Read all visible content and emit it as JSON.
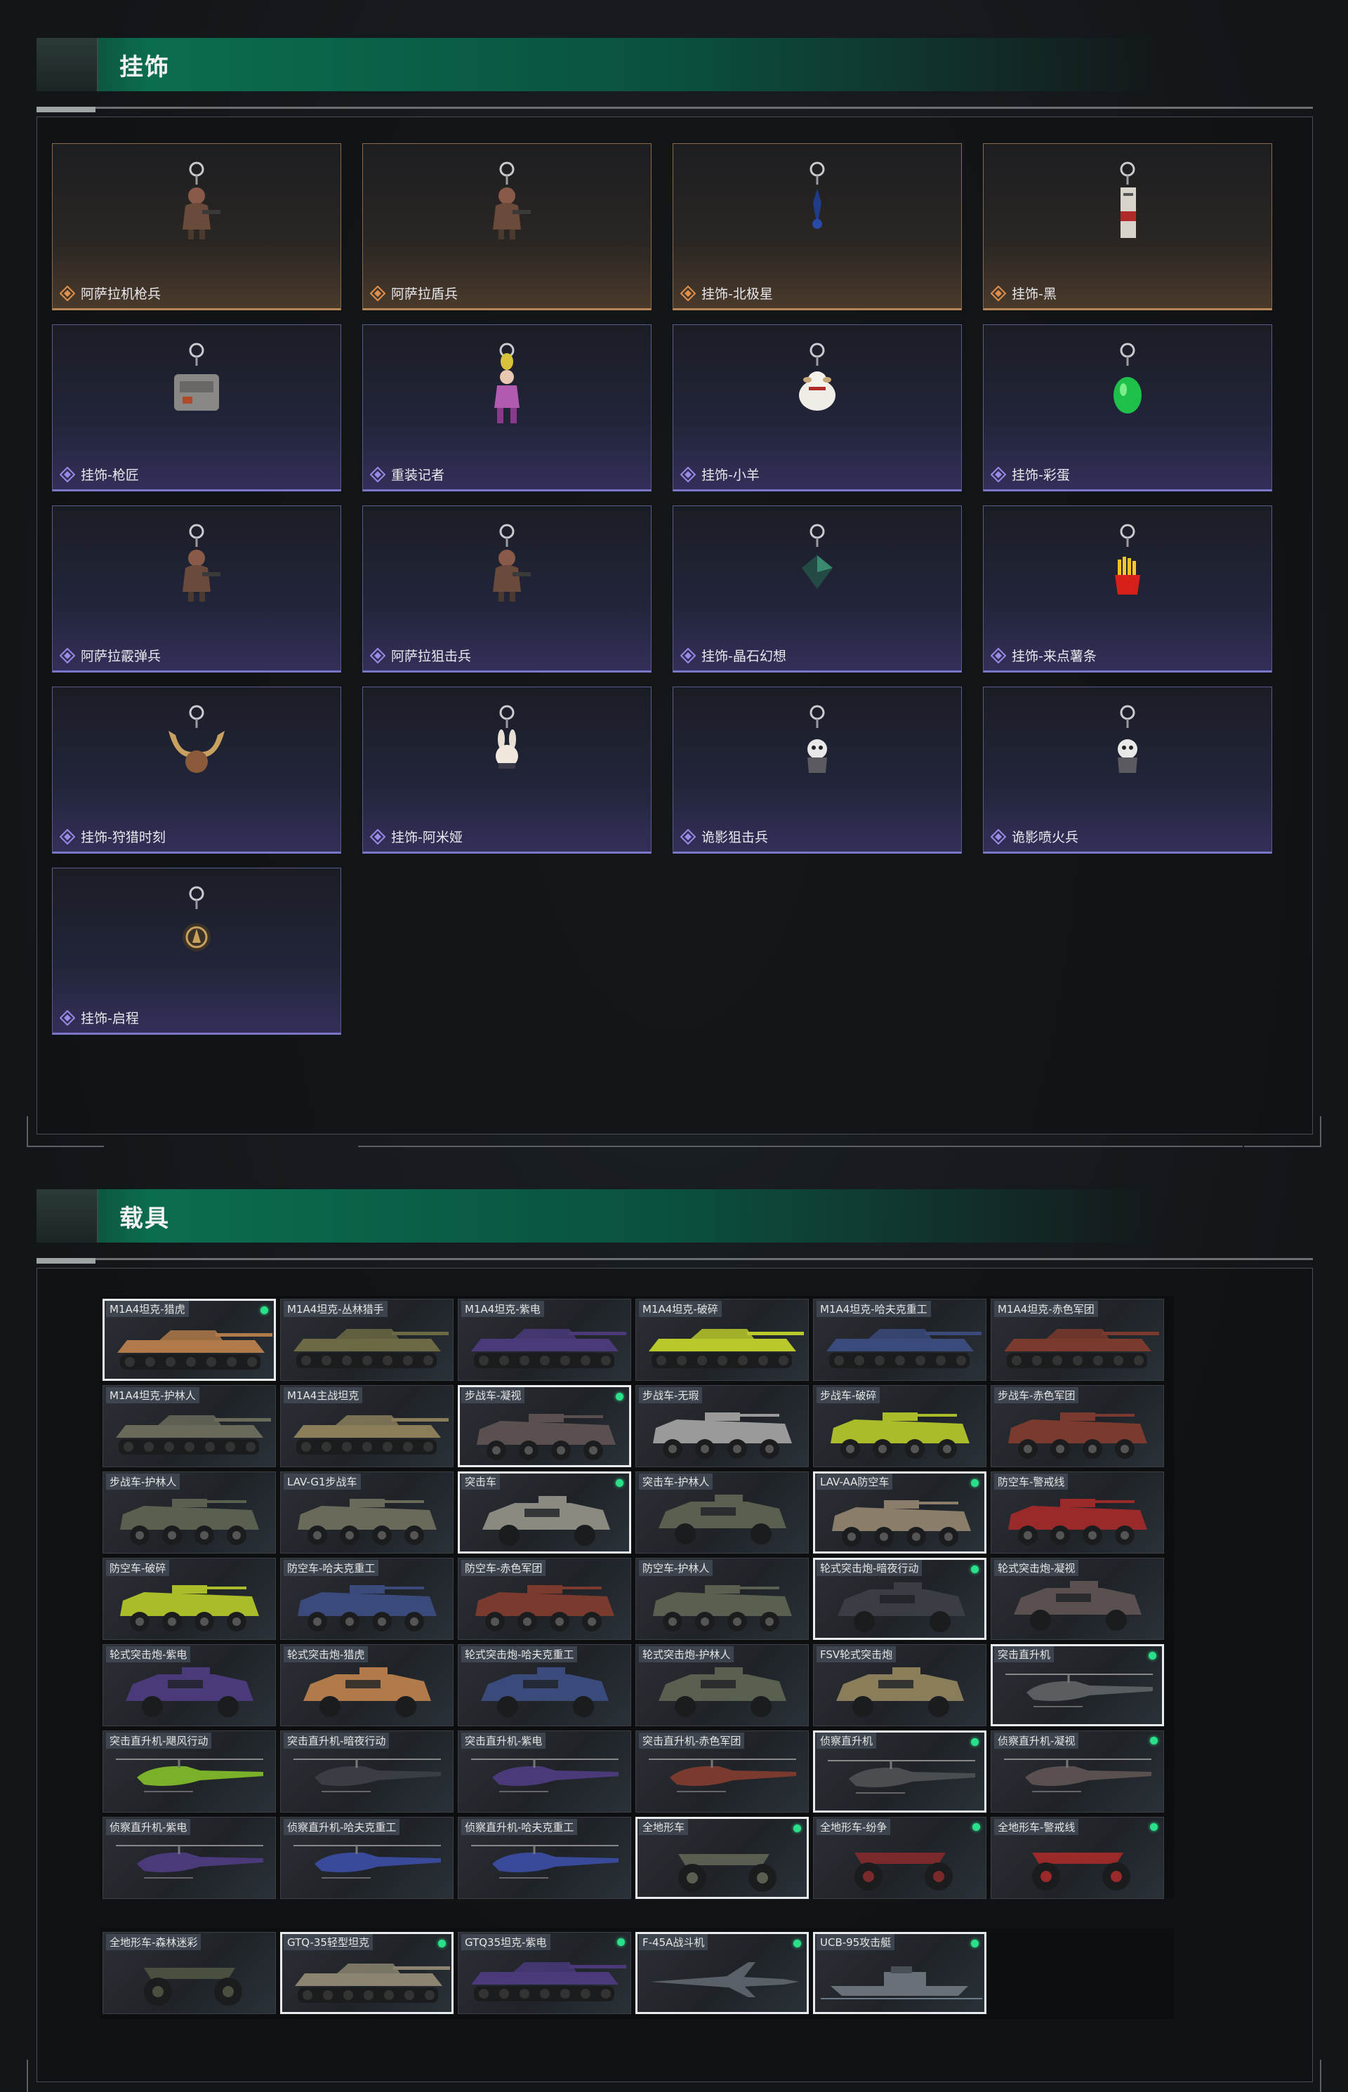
{
  "sections": {
    "pendants_title": "挂饰",
    "vehicles_title": "载具"
  },
  "colors": {
    "accent_green": "#0b6d4f",
    "rarity_orange": "#b88654",
    "rarity_purple": "#7a76c8",
    "owned_dot": "#2be08a"
  },
  "pendants": [
    {
      "name": "阿萨拉机枪兵",
      "rarity": "orange",
      "icon": "soldier-charm-icon"
    },
    {
      "name": "阿萨拉盾兵",
      "rarity": "orange",
      "icon": "soldier-charm-icon"
    },
    {
      "name": "挂饰-北极星",
      "rarity": "orange",
      "icon": "star-charm-icon"
    },
    {
      "name": "挂饰-黑",
      "rarity": "orange",
      "icon": "tag-charm-icon"
    },
    {
      "name": "挂饰-枪匠",
      "rarity": "purple",
      "icon": "box-charm-icon"
    },
    {
      "name": "重装记者",
      "rarity": "purple",
      "icon": "figure-charm-icon"
    },
    {
      "name": "挂饰-小羊",
      "rarity": "purple",
      "icon": "sheep-charm-icon"
    },
    {
      "name": "挂饰-彩蛋",
      "rarity": "purple",
      "icon": "egg-charm-icon"
    },
    {
      "name": "阿萨拉霰弹兵",
      "rarity": "purple",
      "icon": "soldier-charm-icon"
    },
    {
      "name": "阿萨拉狙击兵",
      "rarity": "purple",
      "icon": "soldier-charm-icon"
    },
    {
      "name": "挂饰-晶石幻想",
      "rarity": "purple",
      "icon": "crystal-charm-icon"
    },
    {
      "name": "挂饰-来点薯条",
      "rarity": "purple",
      "icon": "fries-charm-icon"
    },
    {
      "name": "挂饰-狩猎时刻",
      "rarity": "purple",
      "icon": "antler-charm-icon"
    },
    {
      "name": "挂饰-阿米娅",
      "rarity": "purple",
      "icon": "bunny-charm-icon"
    },
    {
      "name": "诡影狙击兵",
      "rarity": "purple",
      "icon": "ghost-charm-icon"
    },
    {
      "name": "诡影喷火兵",
      "rarity": "purple",
      "icon": "ghost-charm-icon"
    },
    {
      "name": "挂饰-启程",
      "rarity": "purple",
      "icon": "medal-charm-icon"
    }
  ],
  "vehicles": [
    {
      "name": "M1A4坦克-猎虎",
      "selected": true,
      "owned": true,
      "kind": "tank",
      "tint": "#b07a4a"
    },
    {
      "name": "M1A4坦克-丛林猎手",
      "selected": false,
      "owned": false,
      "kind": "tank",
      "tint": "#6b6a44"
    },
    {
      "name": "M1A4坦克-紫电",
      "selected": false,
      "owned": false,
      "kind": "tank",
      "tint": "#4a3a7a"
    },
    {
      "name": "M1A4坦克-破碎",
      "selected": false,
      "owned": false,
      "kind": "tank",
      "tint": "#b9c82a"
    },
    {
      "name": "M1A4坦克-哈夫克重工",
      "selected": false,
      "owned": false,
      "kind": "tank",
      "tint": "#3a4a7a"
    },
    {
      "name": "M1A4坦克-赤色军团",
      "selected": false,
      "owned": false,
      "kind": "tank",
      "tint": "#7a3a2e"
    },
    {
      "name": "M1A4坦克-护林人",
      "selected": false,
      "owned": false,
      "kind": "tank",
      "tint": "#6a6a5a"
    },
    {
      "name": "M1A4主战坦克",
      "selected": false,
      "owned": false,
      "kind": "tank",
      "tint": "#8a7e5a"
    },
    {
      "name": "步战车-凝视",
      "selected": true,
      "owned": true,
      "kind": "apc",
      "tint": "#5a5050"
    },
    {
      "name": "步战车-无瑕",
      "selected": false,
      "owned": false,
      "kind": "apc",
      "tint": "#9a9a9a"
    },
    {
      "name": "步战车-破碎",
      "selected": false,
      "owned": false,
      "kind": "apc",
      "tint": "#aabc2a"
    },
    {
      "name": "步战车-赤色军团",
      "selected": false,
      "owned": false,
      "kind": "apc",
      "tint": "#7a3a2e"
    },
    {
      "name": "步战车-护林人",
      "selected": false,
      "owned": false,
      "kind": "apc",
      "tint": "#5a6050"
    },
    {
      "name": "LAV-G1步战车",
      "selected": false,
      "owned": false,
      "kind": "apc",
      "tint": "#6a6a5a"
    },
    {
      "name": "突击车",
      "selected": true,
      "owned": true,
      "kind": "car",
      "tint": "#8a8a80"
    },
    {
      "name": "突击车-护林人",
      "selected": false,
      "owned": false,
      "kind": "car",
      "tint": "#5a6050"
    },
    {
      "name": "LAV-AA防空车",
      "selected": true,
      "owned": true,
      "kind": "apc",
      "tint": "#8a7e6a"
    },
    {
      "name": "防空车-警戒线",
      "selected": false,
      "owned": false,
      "kind": "apc",
      "tint": "#9a2a2a"
    },
    {
      "name": "防空车-破碎",
      "selected": false,
      "owned": false,
      "kind": "apc",
      "tint": "#aabc2a"
    },
    {
      "name": "防空车-哈夫克重工",
      "selected": false,
      "owned": false,
      "kind": "apc",
      "tint": "#3a4a7a"
    },
    {
      "name": "防空车-赤色军团",
      "selected": false,
      "owned": false,
      "kind": "apc",
      "tint": "#7a3a2e"
    },
    {
      "name": "防空车-护林人",
      "selected": false,
      "owned": false,
      "kind": "apc",
      "tint": "#5a6050"
    },
    {
      "name": "轮式突击炮-暗夜行动",
      "selected": true,
      "owned": true,
      "kind": "car",
      "tint": "#3a3e44"
    },
    {
      "name": "轮式突击炮-凝视",
      "selected": false,
      "owned": false,
      "kind": "car",
      "tint": "#5a5050"
    },
    {
      "name": "轮式突击炮-紫电",
      "selected": false,
      "owned": false,
      "kind": "car",
      "tint": "#4a3a7a"
    },
    {
      "name": "轮式突击炮-猎虎",
      "selected": false,
      "owned": false,
      "kind": "car",
      "tint": "#b07a4a"
    },
    {
      "name": "轮式突击炮-哈夫克重工",
      "selected": false,
      "owned": false,
      "kind": "car",
      "tint": "#3a4a7a"
    },
    {
      "name": "轮式突击炮-护林人",
      "selected": false,
      "owned": false,
      "kind": "car",
      "tint": "#5a6050"
    },
    {
      "name": "FSV轮式突击炮",
      "selected": false,
      "owned": false,
      "kind": "car",
      "tint": "#8a7e5a"
    },
    {
      "name": "突击直升机",
      "selected": true,
      "owned": true,
      "kind": "heli",
      "tint": "#5a5e60"
    },
    {
      "name": "突击直升机-飓风行动",
      "selected": false,
      "owned": false,
      "kind": "heli",
      "tint": "#7ab02a"
    },
    {
      "name": "突击直升机-暗夜行动",
      "selected": false,
      "owned": false,
      "kind": "heli",
      "tint": "#3a3e44"
    },
    {
      "name": "突击直升机-紫电",
      "selected": false,
      "owned": false,
      "kind": "heli",
      "tint": "#4a3a7a"
    },
    {
      "name": "突击直升机-赤色军团",
      "selected": false,
      "owned": false,
      "kind": "heli",
      "tint": "#7a3a2e"
    },
    {
      "name": "侦察直升机",
      "selected": true,
      "owned": true,
      "kind": "heli",
      "tint": "#4a4e50"
    },
    {
      "name": "侦察直升机-凝视",
      "selected": false,
      "owned": true,
      "kind": "heli",
      "tint": "#5a5050"
    },
    {
      "name": "侦察直升机-紫电",
      "selected": false,
      "owned": false,
      "kind": "heli",
      "tint": "#4a3a7a"
    },
    {
      "name": "侦察直升机-哈夫克重工",
      "selected": false,
      "owned": false,
      "kind": "heli",
      "tint": "#3a4a9a"
    },
    {
      "name": "侦察直升机-哈夫克重工",
      "selected": false,
      "owned": false,
      "kind": "heli",
      "tint": "#3a4a9a"
    },
    {
      "name": "全地形车",
      "selected": true,
      "owned": true,
      "kind": "atv",
      "tint": "#5a5e50"
    },
    {
      "name": "全地形车-纷争",
      "selected": false,
      "owned": true,
      "kind": "atv",
      "tint": "#7a2a2a"
    },
    {
      "name": "全地形车-警戒线",
      "selected": false,
      "owned": true,
      "kind": "atv",
      "tint": "#9a2a2a"
    }
  ],
  "vehicles_extra": [
    {
      "name": "全地形车-森林迷彩",
      "selected": false,
      "owned": false,
      "kind": "atv",
      "tint": "#4a5040"
    },
    {
      "name": "GTQ-35轻型坦克",
      "selected": true,
      "owned": true,
      "kind": "tank",
      "tint": "#8a8470"
    },
    {
      "name": "GTQ35坦克-紫电",
      "selected": false,
      "owned": true,
      "kind": "tank",
      "tint": "#4a3a7a"
    },
    {
      "name": "F-45A战斗机",
      "selected": true,
      "owned": true,
      "kind": "jet",
      "tint": "#5a6068"
    },
    {
      "name": "UCB-95攻击艇",
      "selected": true,
      "owned": true,
      "kind": "boat",
      "tint": "#6a7078"
    }
  ]
}
